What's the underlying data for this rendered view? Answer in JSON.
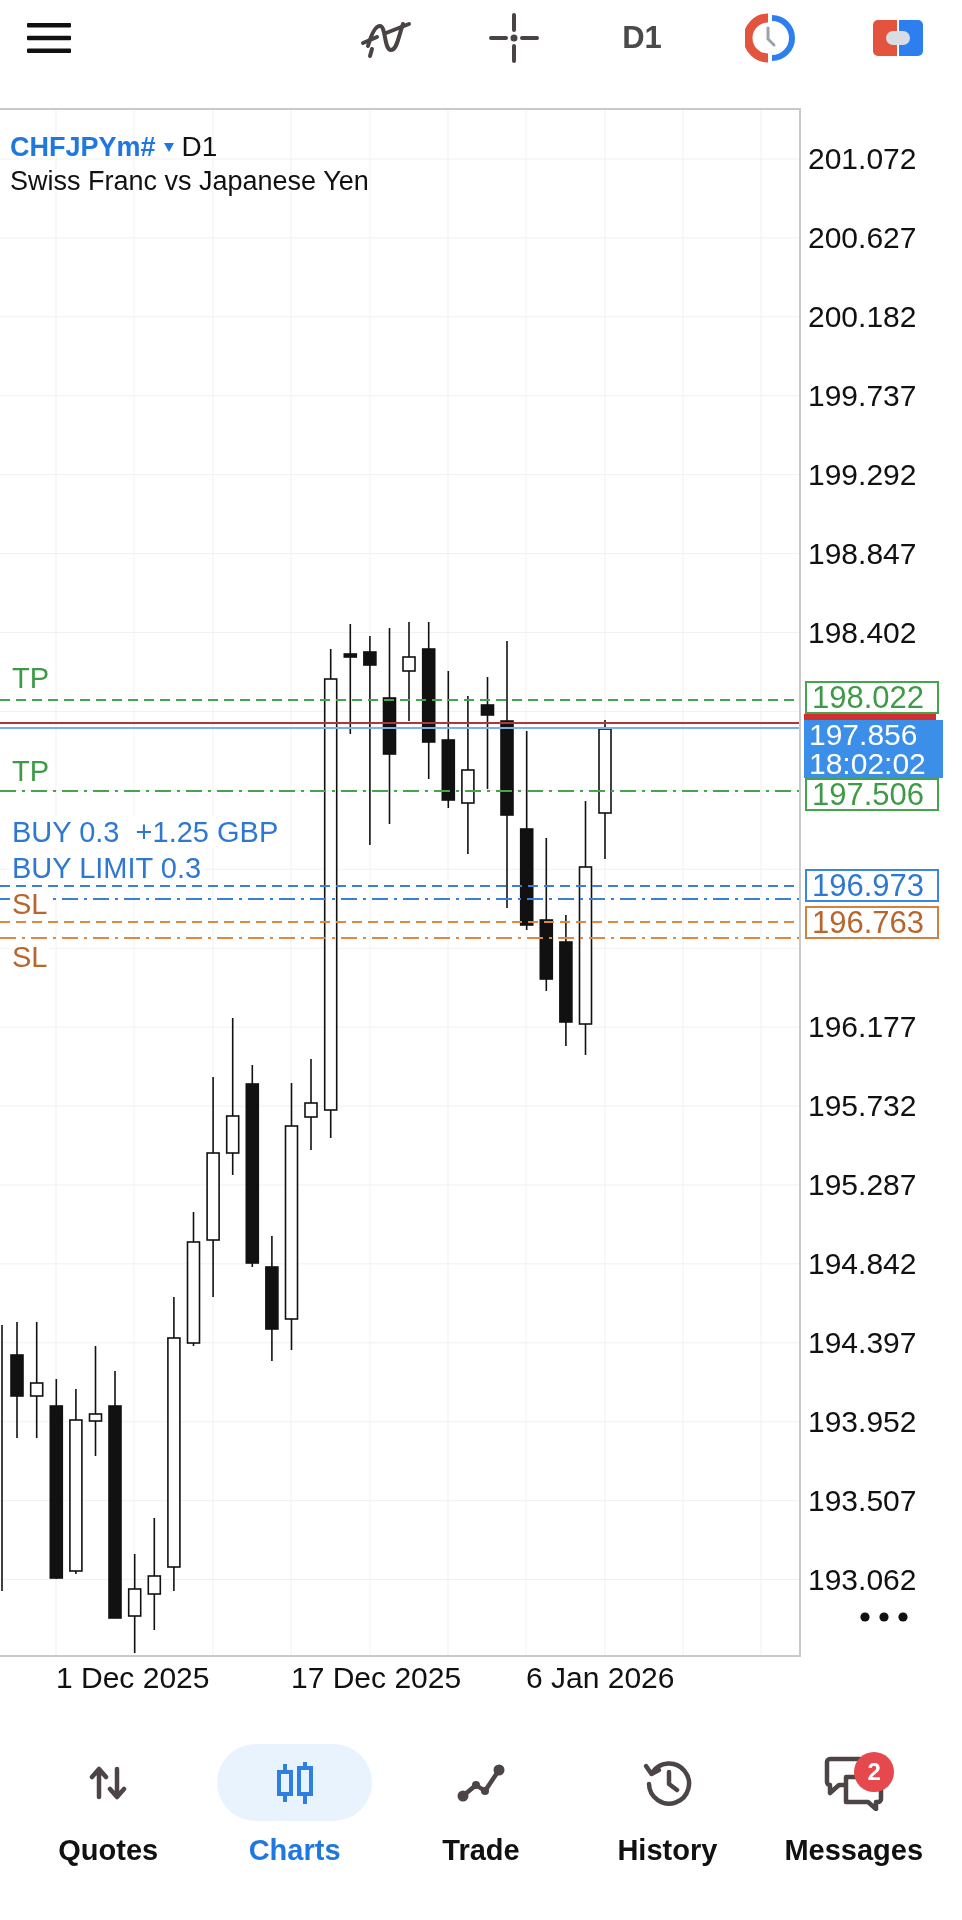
{
  "toolbar": {
    "timeframe": "D1"
  },
  "chart": {
    "symbol": "CHFJPYm#",
    "timeframe": "D1",
    "description": "Swiss Franc vs Japanese Yen",
    "price_axis": [
      "201.072",
      "200.627",
      "200.182",
      "199.737",
      "199.292",
      "198.847",
      "198.402",
      "196.177",
      "195.732",
      "195.287",
      "194.842",
      "194.397",
      "193.952",
      "193.507",
      "193.062"
    ],
    "time_axis": [
      "1 Dec 2025",
      "17 Dec 2025",
      "6 Jan 2026"
    ],
    "current_price": {
      "bid": "197.856",
      "countdown": "18:02:02"
    },
    "order_lines": [
      {
        "kind": "take_profit",
        "label": "TP",
        "price": "198.022",
        "dash_dot": false
      },
      {
        "kind": "take_profit",
        "label": "TP",
        "price": "197.506",
        "dash_dot": true
      },
      {
        "kind": "position",
        "label": "BUY 0.3  +1.25 GBP",
        "price": "196.973",
        "dash_dot": false
      },
      {
        "kind": "pending",
        "label": "BUY LIMIT 0.3",
        "dash_dot": true
      },
      {
        "kind": "stop_loss",
        "label": "SL",
        "price": "196.763",
        "dash_dot": false
      },
      {
        "kind": "stop_loss",
        "label": "SL",
        "dash_dot": true
      }
    ]
  },
  "bottom_nav": [
    {
      "label": "Quotes",
      "selected": false
    },
    {
      "label": "Charts",
      "selected": true
    },
    {
      "label": "Trade",
      "selected": false
    },
    {
      "label": "History",
      "selected": false
    },
    {
      "label": "Messages",
      "selected": false,
      "badge": "2"
    }
  ]
}
